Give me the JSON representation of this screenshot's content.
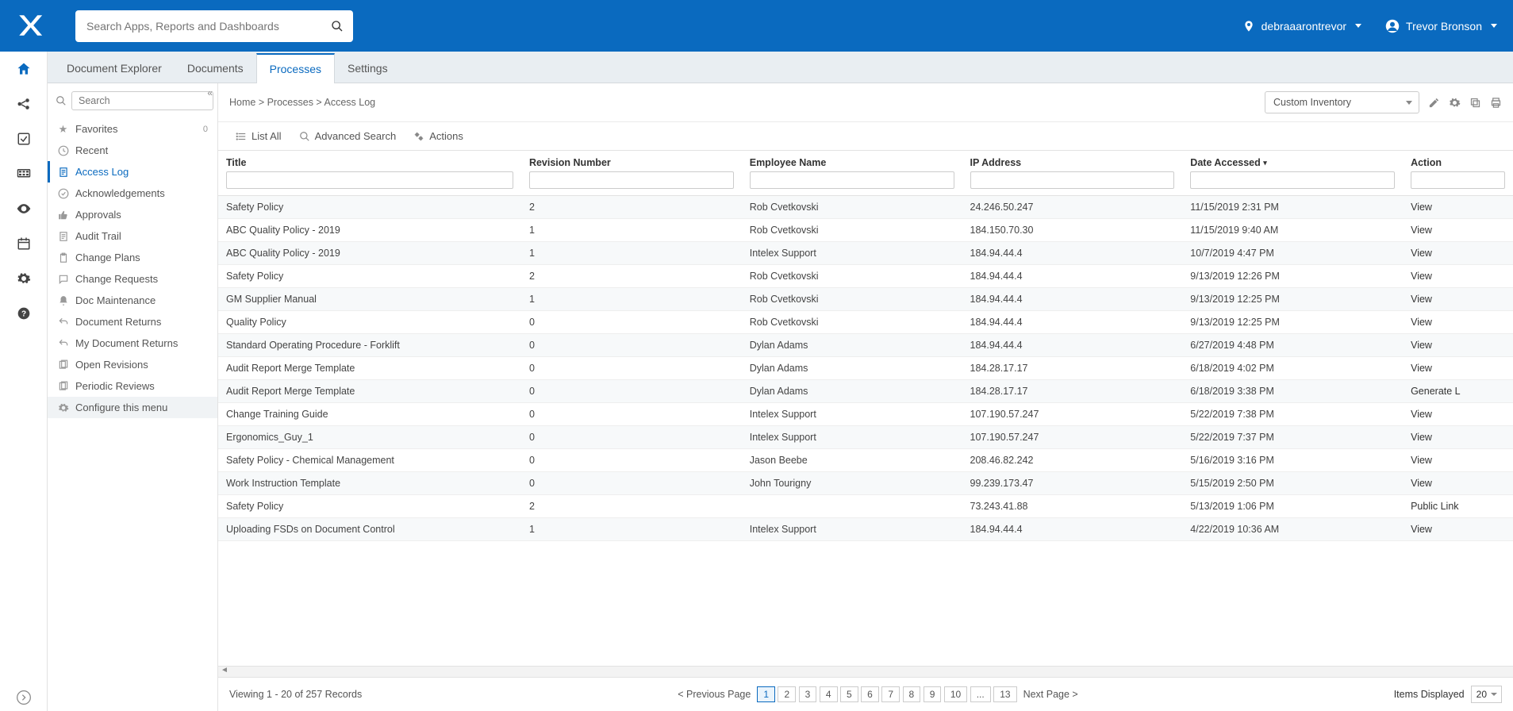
{
  "header": {
    "search_placeholder": "Search Apps, Reports and Dashboards",
    "location": "debraaarontrevor",
    "user": "Trevor Bronson"
  },
  "tabs": [
    {
      "label": "Document Explorer",
      "active": false
    },
    {
      "label": "Documents",
      "active": false
    },
    {
      "label": "Processes",
      "active": true
    },
    {
      "label": "Settings",
      "active": false
    }
  ],
  "sidebar": {
    "search_placeholder": "Search",
    "favorites_label": "Favorites",
    "favorites_count": "0",
    "recent_label": "Recent",
    "items": [
      {
        "label": "Access Log",
        "active": true,
        "icon": "doc"
      },
      {
        "label": "Acknowledgements",
        "icon": "check-circle"
      },
      {
        "label": "Approvals",
        "icon": "thumb"
      },
      {
        "label": "Audit Trail",
        "icon": "doc"
      },
      {
        "label": "Change Plans",
        "icon": "clipboard"
      },
      {
        "label": "Change Requests",
        "icon": "chat"
      },
      {
        "label": "Doc Maintenance",
        "icon": "bell"
      },
      {
        "label": "Document Returns",
        "icon": "return"
      },
      {
        "label": "My Document Returns",
        "icon": "return"
      },
      {
        "label": "Open Revisions",
        "icon": "files"
      },
      {
        "label": "Periodic Reviews",
        "icon": "files"
      }
    ],
    "configure_label": "Configure this menu"
  },
  "breadcrumb": "Home > Processes > Access Log",
  "custom_dropdown": "Custom Inventory",
  "actions": {
    "list_all": "List All",
    "advanced_search": "Advanced Search",
    "actions": "Actions"
  },
  "columns": {
    "title": "Title",
    "revision": "Revision Number",
    "employee": "Employee Name",
    "ip": "IP Address",
    "date": "Date Accessed",
    "action": "Action"
  },
  "rows": [
    {
      "title": "Safety Policy",
      "rev": "2",
      "emp": "Rob  Cvetkovski",
      "ip": "24.246.50.247",
      "date": "11/15/2019 2:31 PM",
      "action": "View"
    },
    {
      "title": "ABC Quality Policy - 2019",
      "rev": "1",
      "emp": "Rob  Cvetkovski",
      "ip": "184.150.70.30",
      "date": "11/15/2019 9:40 AM",
      "action": "View"
    },
    {
      "title": "ABC Quality Policy - 2019",
      "rev": "1",
      "emp": "Intelex Support",
      "ip": "184.94.44.4",
      "date": "10/7/2019 4:47 PM",
      "action": "View"
    },
    {
      "title": "Safety Policy",
      "rev": "2",
      "emp": "Rob  Cvetkovski",
      "ip": "184.94.44.4",
      "date": "9/13/2019 12:26 PM",
      "action": "View"
    },
    {
      "title": "GM Supplier Manual",
      "rev": "1",
      "emp": "Rob  Cvetkovski",
      "ip": "184.94.44.4",
      "date": "9/13/2019 12:25 PM",
      "action": "View"
    },
    {
      "title": "Quality Policy",
      "rev": "0",
      "emp": "Rob  Cvetkovski",
      "ip": "184.94.44.4",
      "date": "9/13/2019 12:25 PM",
      "action": "View"
    },
    {
      "title": "Standard Operating Procedure - Forklift",
      "rev": "0",
      "emp": "Dylan Adams",
      "ip": "184.94.44.4",
      "date": "6/27/2019 4:48 PM",
      "action": "View"
    },
    {
      "title": "Audit Report Merge Template",
      "rev": "0",
      "emp": "Dylan Adams",
      "ip": "184.28.17.17",
      "date": "6/18/2019 4:02 PM",
      "action": "View"
    },
    {
      "title": "Audit Report Merge Template",
      "rev": "0",
      "emp": "Dylan Adams",
      "ip": "184.28.17.17",
      "date": "6/18/2019 3:38 PM",
      "action": "Generate L"
    },
    {
      "title": "Change Training Guide",
      "rev": "0",
      "emp": "Intelex Support",
      "ip": "107.190.57.247",
      "date": "5/22/2019 7:38 PM",
      "action": "View"
    },
    {
      "title": "Ergonomics_Guy_1",
      "rev": "0",
      "emp": "Intelex Support",
      "ip": "107.190.57.247",
      "date": "5/22/2019 7:37 PM",
      "action": "View"
    },
    {
      "title": "Safety Policy - Chemical Management",
      "rev": "0",
      "emp": "Jason Beebe",
      "ip": "208.46.82.242",
      "date": "5/16/2019 3:16 PM",
      "action": "View"
    },
    {
      "title": "Work Instruction Template",
      "rev": "0",
      "emp": "John Tourigny",
      "ip": "99.239.173.47",
      "date": "5/15/2019 2:50 PM",
      "action": "View"
    },
    {
      "title": "Safety Policy",
      "rev": "2",
      "emp": "",
      "ip": "73.243.41.88",
      "date": "5/13/2019 1:06 PM",
      "action": "Public Link"
    },
    {
      "title": "Uploading FSDs on Document Control",
      "rev": "1",
      "emp": "Intelex Support",
      "ip": "184.94.44.4",
      "date": "4/22/2019 10:36 AM",
      "action": "View"
    }
  ],
  "footer": {
    "records": "Viewing 1 - 20 of 257 Records",
    "prev": "< Previous Page",
    "next": "Next Page >",
    "pages": [
      "1",
      "2",
      "3",
      "4",
      "5",
      "6",
      "7",
      "8",
      "9",
      "10",
      "...",
      "13"
    ],
    "items_label": "Items Displayed",
    "items_value": "20"
  }
}
